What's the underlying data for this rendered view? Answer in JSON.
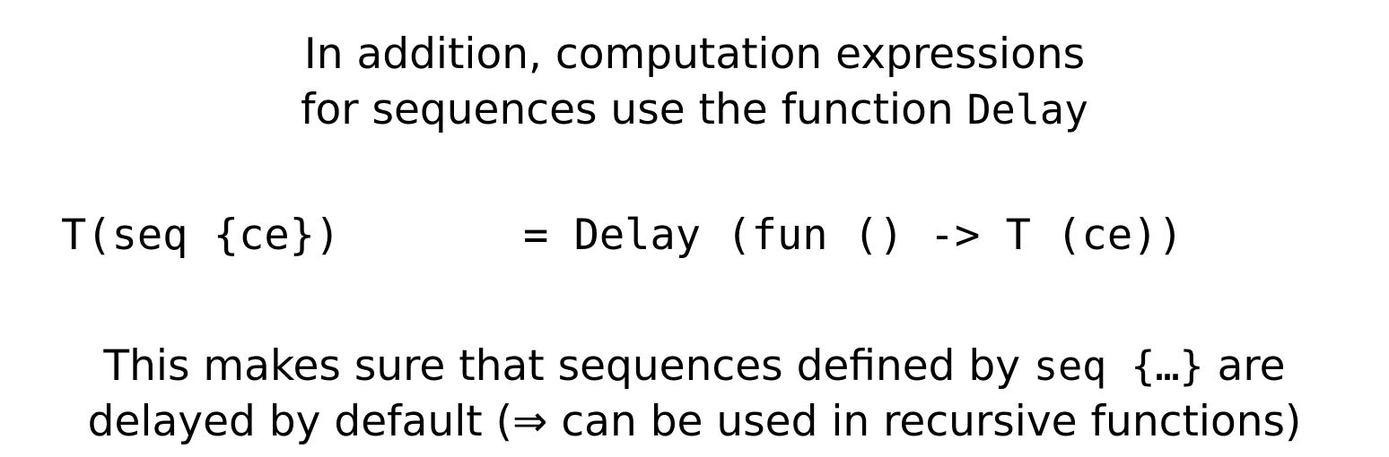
{
  "intro": {
    "line1": "In addition, computation expressions",
    "line2_prefix": "for sequences use the function ",
    "line2_code": "Delay"
  },
  "formula": {
    "lhs": "T(seq {ce})",
    "rhs": "= Delay (fun () -> T (ce))"
  },
  "outro": {
    "line1_prefix": "This makes sure that sequences defined by ",
    "line1_code": "seq {…}",
    "line1_suffix": " are",
    "line2": "delayed by default (⇒ can be used in recursive functions)"
  }
}
